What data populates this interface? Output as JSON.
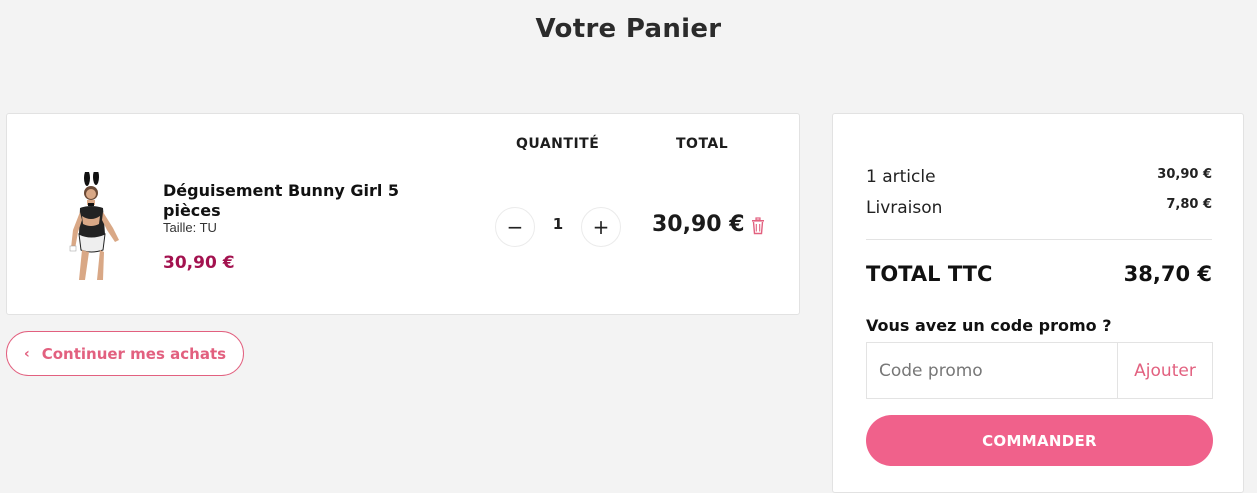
{
  "page": {
    "title": "Votre Panier"
  },
  "cart": {
    "headers": {
      "quantity": "QUANTITÉ",
      "total": "TOTAL"
    },
    "item": {
      "name": "Déguisement Bunny Girl 5 pièces",
      "size": "Taille: TU",
      "price": "30,90 €",
      "quantity": "1",
      "line_total": "30,90 €",
      "minus_symbol": "−",
      "plus_symbol": "+"
    },
    "continue_label": "Continuer mes achats",
    "continue_icon": "chevron-left-icon"
  },
  "summary": {
    "articles_label": "1 article",
    "articles_value": "30,90 €",
    "shipping_label": "Livraison",
    "shipping_value": "7,80 €",
    "total_label": "TOTAL TTC",
    "total_value": "38,70 €",
    "promo_question": "Vous avez un code promo ?",
    "promo_placeholder": "Code promo",
    "promo_add": "Ajouter",
    "order_label": "COMMANDER"
  },
  "colors": {
    "accent": "#f0618b",
    "accent_outline": "#e2607f",
    "price": "#a3124f",
    "background": "#f3f3f3"
  }
}
